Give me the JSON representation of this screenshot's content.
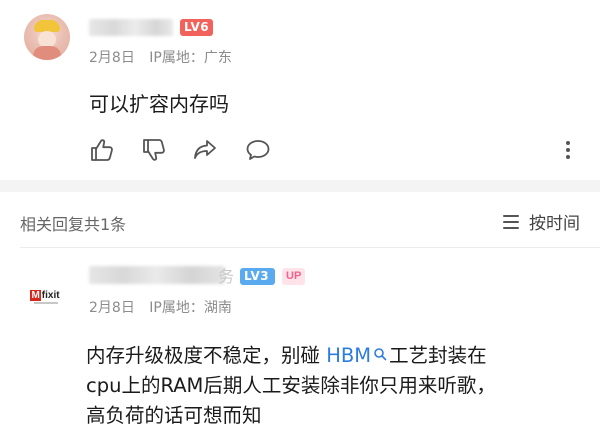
{
  "comment": {
    "level_badge": "LV6",
    "date": "2月8日",
    "ip_location": "IP属地：广东",
    "content": "可以扩容内存吗",
    "actions": [
      "like-icon",
      "dislike-icon",
      "share-icon",
      "reply-icon",
      "more-icon"
    ]
  },
  "replies_header": {
    "count_label": "相关回复共1条",
    "sort_label": "按时间",
    "sort_icon": "menu-icon"
  },
  "reply": {
    "avatar_logo": "Mfixit",
    "name_tail": "务",
    "level_badge": "LV3",
    "up_badge": "UP",
    "date": "2月8日",
    "ip_location": "IP属地：湖南",
    "content": {
      "line1_before": "内存升级极度不稳定，别碰 ",
      "link_text": "HBM",
      "line1_after": "工艺封装在",
      "line2": "cpu上的RAM后期人工安装除非你只用来听歌，",
      "line3": "高负荷的话可想而知"
    }
  },
  "colors": {
    "lv6": "#f2625c",
    "lv3": "#5aaaf0",
    "link": "#2c7de0",
    "up_text": "#f2628a",
    "up_bg": "#ffe3ea"
  }
}
